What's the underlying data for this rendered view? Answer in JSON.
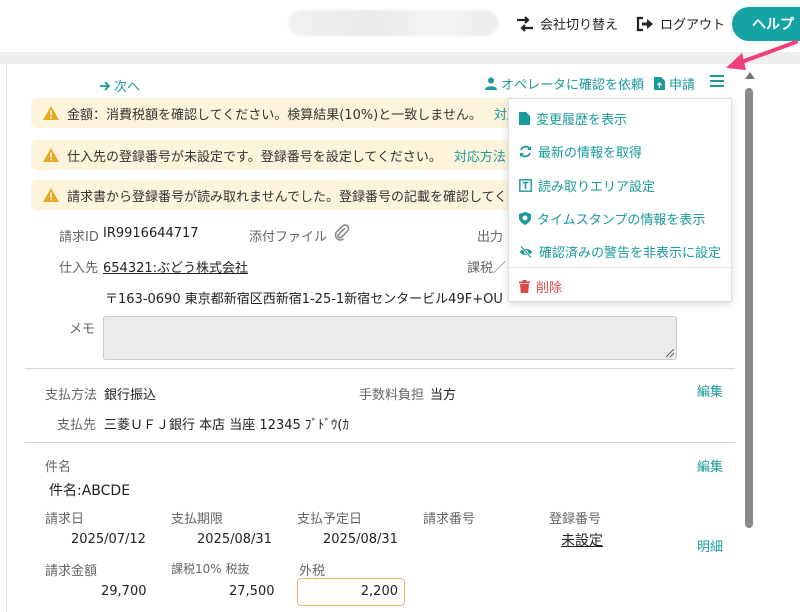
{
  "header": {
    "switch_company": "会社切り替え",
    "logout": "ログアウト",
    "help": "ヘルプ"
  },
  "toolbar": {
    "next": "次へ",
    "ask_operator": "オペレータに確認を依頼",
    "apply": "申請"
  },
  "alerts": [
    {
      "text": "金額：消費税額を確認してください。検算結果(10%)と一致しません。",
      "link": "対応方法"
    },
    {
      "text": "仕入先の登録番号が未設定です。登録番号を設定してください。",
      "link": "対応方法"
    },
    {
      "text": "請求書から登録番号が読み取れませんでした。登録番号の記載を確認してください。",
      "link": ""
    }
  ],
  "invoice": {
    "id_label": "請求ID",
    "id_value": "IR9916644717",
    "attachment_label": "添付ファイル",
    "output_label": "出力",
    "supplier_label": "仕入先",
    "supplier_value": "654321:ぶどう株式会社",
    "tax_label": "課税／",
    "address": "〒163-0690 東京都新宿区西新宿1-25-1新宿センタービル49F+OU",
    "memo_label": "メモ"
  },
  "payment": {
    "method_label": "支払方法",
    "method_value": "銀行振込",
    "fee_label": "手数料負担",
    "fee_value": "当方",
    "edit": "編集",
    "payee_label": "支払先",
    "payee_value": "三菱ＵＦＪ銀行 本店 当座 12345 ﾌﾞﾄﾞｳ(ｶ"
  },
  "subject": {
    "label": "件名",
    "value": "件名:ABCDE",
    "edit": "編集"
  },
  "details": {
    "billing_date_label": "請求日",
    "billing_date": "2025/07/12",
    "due_label": "支払期限",
    "due": "2025/08/31",
    "scheduled_label": "支払予定日",
    "scheduled": "2025/08/31",
    "invoice_no_label": "請求番号",
    "reg_no_label": "登録番号",
    "reg_no_value": "未設定",
    "detail_link": "明細",
    "amount_label": "請求金額",
    "amount": "29,700",
    "taxable_label": "課税10% 税抜",
    "taxable": "27,500",
    "ext_tax_label": "外税",
    "ext_tax": "2,200"
  },
  "menu": {
    "items": [
      {
        "label": "変更履歴を表示",
        "icon": "file-icon"
      },
      {
        "label": "最新の情報を取得",
        "icon": "refresh-icon"
      },
      {
        "label": "読み取りエリア設定",
        "icon": "text-area-icon"
      },
      {
        "label": "タイムスタンプの情報を表示",
        "icon": "shield-icon"
      },
      {
        "label": "確認済みの警告を非表示に設定",
        "icon": "eye-slash-icon"
      },
      {
        "label": "削除",
        "icon": "trash-icon"
      }
    ]
  },
  "colors": {
    "accent": "#1a9a9a",
    "help": "#15a2a2",
    "alert_bg": "#fdf4dc",
    "warn": "#e9a820",
    "danger": "#e04848",
    "annotation": "#f0407a"
  }
}
